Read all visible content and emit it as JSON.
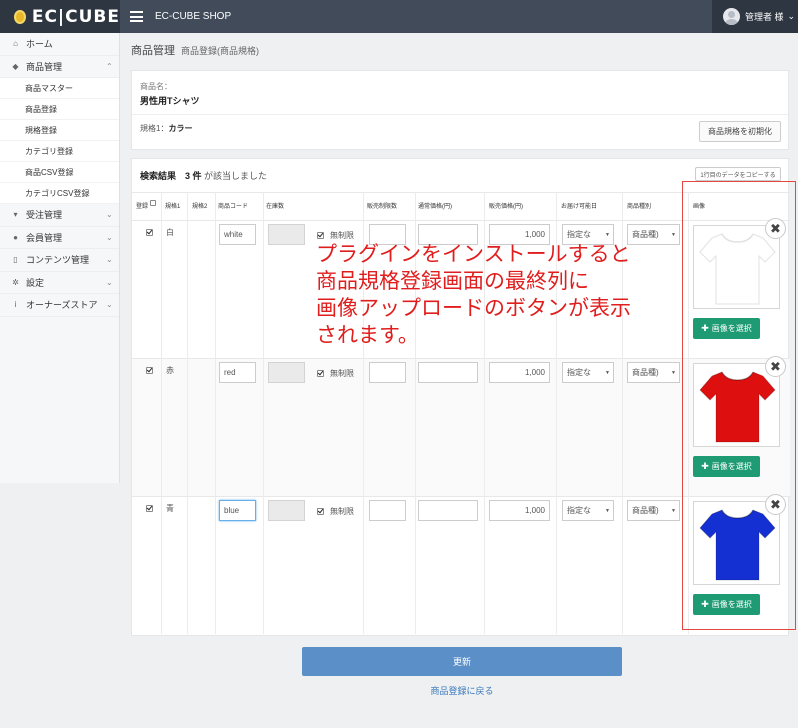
{
  "header": {
    "logo": "EC|CUBE",
    "shop_name": "EC-CUBE SHOP",
    "user_name": "管理者 様",
    "user_chevron": "⌄"
  },
  "sidebar": {
    "items": [
      {
        "label": "ホーム",
        "icon": "home-icon",
        "glyph": "⌂",
        "chevron": ""
      },
      {
        "label": "商品管理",
        "icon": "tag-icon",
        "glyph": "◆",
        "chevron": "⌃"
      },
      {
        "label": "受注管理",
        "icon": "cart-icon",
        "glyph": "▾",
        "chevron": "⌄"
      },
      {
        "label": "会員管理",
        "icon": "users-icon",
        "glyph": "●",
        "chevron": "⌄"
      },
      {
        "label": "コンテンツ管理",
        "icon": "file-icon",
        "glyph": "▯",
        "chevron": "⌄"
      },
      {
        "label": "設定",
        "icon": "gear-icon",
        "glyph": "✲",
        "chevron": "⌄"
      },
      {
        "label": "オーナーズストア",
        "icon": "info-icon",
        "glyph": "i",
        "chevron": "⌄"
      }
    ],
    "subitems": [
      "商品マスター",
      "商品登録",
      "規格登録",
      "カテゴリ登録",
      "商品CSV登録",
      "カテゴリCSV登録"
    ]
  },
  "page": {
    "title": "商品管理",
    "subtitle": "商品登録(商品規格)"
  },
  "product": {
    "name_label": "商品名：",
    "name_value": "男性用Tシャツ",
    "spec_label": "規格1：",
    "spec_value": "カラー",
    "init_button": "商品規格を初期化"
  },
  "results": {
    "title": "検索結果",
    "count": "3 件",
    "count_suffix": "が該当しました",
    "copy_button": "1行目のデータをコピーする"
  },
  "table": {
    "headers": [
      "登録",
      "規格1",
      "規格2",
      "商品コード",
      "在庫数",
      "販売制限数",
      "通常価格(円)",
      "販売価格(円)",
      "お届け可能日",
      "商品種別",
      "画像"
    ],
    "unlimited_label": "無制限",
    "delivery_placeholder": "指定な",
    "product_type_placeholder": "商品種)",
    "select_image_label": "画像を選択",
    "rows": [
      {
        "class1": "白",
        "code": "white",
        "price": "1,000",
        "color": "#ffffff",
        "color_name": "white"
      },
      {
        "class1": "赤",
        "code": "red",
        "price": "1,000",
        "color": "#dd0f0f",
        "color_name": "red"
      },
      {
        "class1": "青",
        "code": "blue",
        "price": "1,000",
        "color": "#1530d2",
        "color_name": "blue"
      }
    ]
  },
  "annotation": {
    "text": "プラグインをインストールすると商品規格登録画面の最終列に画像アップロードのボタンが表示されます。",
    "lines": [
      "プラグインをインストールすると",
      "商品規格登録画面の最終列に",
      "画像アップロードのボタンが表示",
      "されます。"
    ],
    "color": "#e01e1e"
  },
  "footer": {
    "update_button": "更新",
    "back_link": "商品登録に戻る"
  }
}
